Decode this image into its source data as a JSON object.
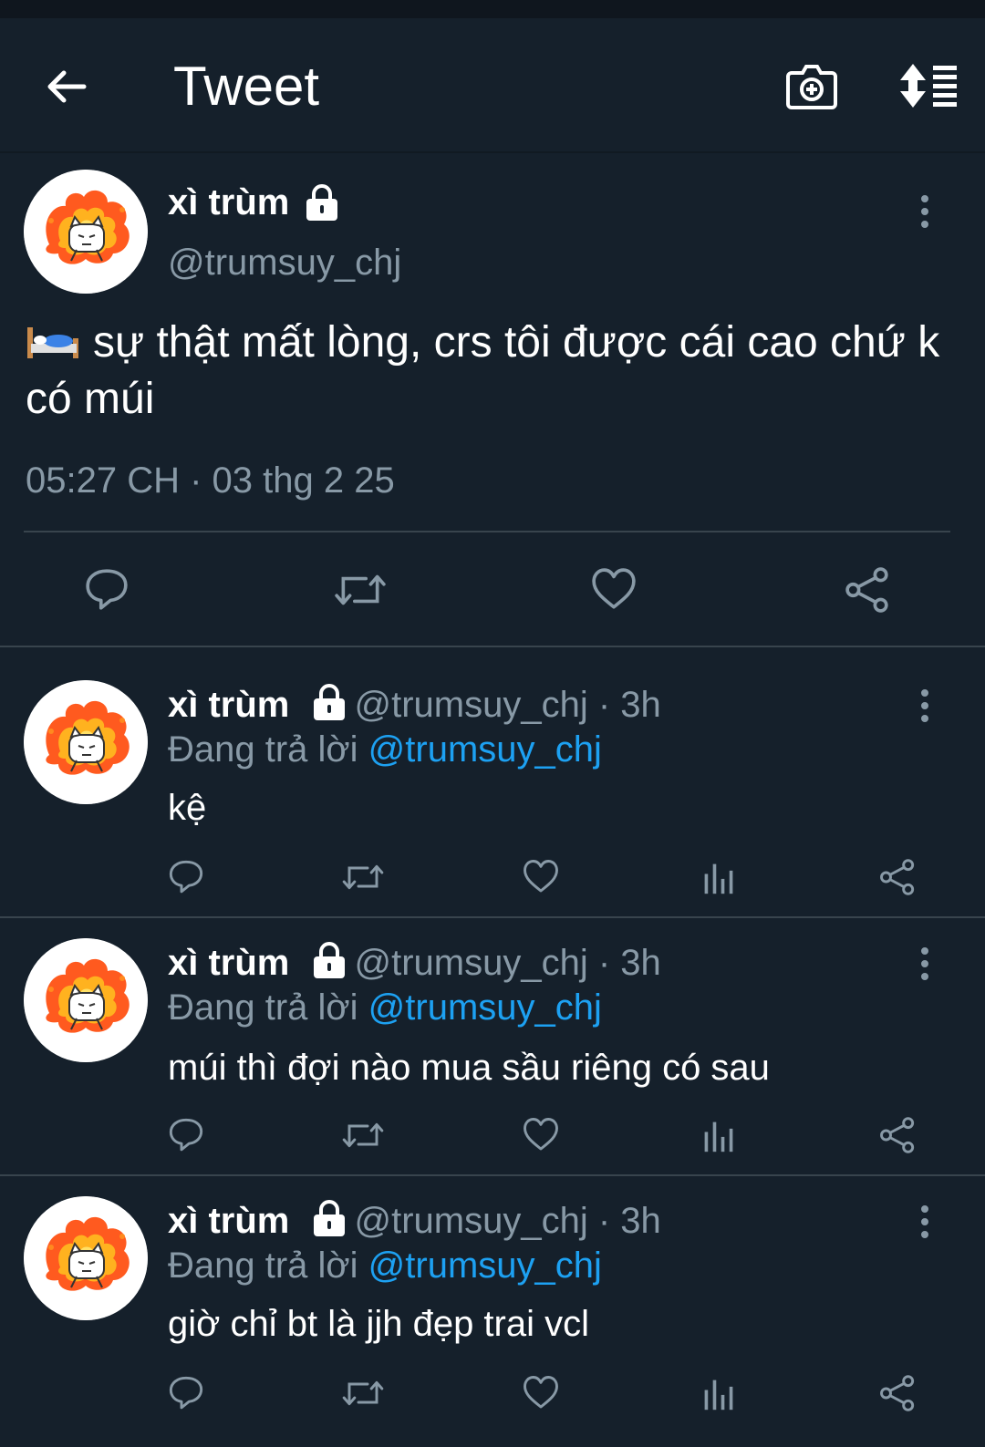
{
  "header": {
    "title": "Tweet"
  },
  "main_tweet": {
    "author_name": "xì trùm",
    "author_handle": "@trumsuy_chj",
    "text": "sự thật mất lòng, crs tôi được cái cao chứ k có múi",
    "emoji": "bed",
    "timestamp": "05:27 CH · 03 thg 2 25"
  },
  "replies": [
    {
      "author_name": "xì trùm",
      "handle_time": "@trumsuy_chj · 3h",
      "replying_prefix": "Đang trả lời",
      "replying_to": "@trumsuy_chj",
      "text": "kệ"
    },
    {
      "author_name": "xì trùm",
      "handle_time": "@trumsuy_chj · 3h",
      "replying_prefix": "Đang trả lời",
      "replying_to": "@trumsuy_chj",
      "text": "múi thì đợi nào mua sầu riêng có sau"
    },
    {
      "author_name": "xì trùm",
      "handle_time": "@trumsuy_chj · 3h",
      "replying_prefix": "Đang trả lời",
      "replying_to": "@trumsuy_chj",
      "text": "giờ chỉ bt là jjh đẹp trai vcl"
    }
  ],
  "icons": [
    "back-arrow-icon",
    "camera-icon",
    "sort-icon",
    "lock-icon",
    "more-icon",
    "reply-icon",
    "retweet-icon",
    "like-icon",
    "analytics-icon",
    "share-icon"
  ],
  "colors": {
    "background": "#15202b",
    "accent": "#1da1f2",
    "secondary_text": "#8899a6"
  }
}
